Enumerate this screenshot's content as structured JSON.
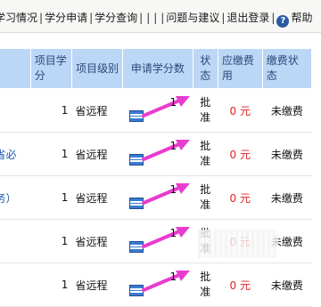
{
  "nav": {
    "items": [
      "学习情况",
      "学分申请",
      "学分查询",
      "|",
      "|",
      "问题与建议",
      "退出登录"
    ],
    "help_label": "帮助"
  },
  "table": {
    "headers": [
      "",
      "项目学分",
      "项目级别",
      "申请学分数",
      "状态",
      "应缴费用",
      "缴费状态"
    ],
    "rows": [
      {
        "name": "",
        "credit": "1",
        "level": "省远程",
        "apply": "1",
        "status": "批准",
        "fee": "0 元",
        "pay_status": "未缴费"
      },
      {
        "name": "省必",
        "credit": "1",
        "level": "省远程",
        "apply": "1",
        "status": "批准",
        "fee": "0 元",
        "pay_status": "未缴费"
      },
      {
        "name": "务）",
        "credit": "1",
        "level": "省远程",
        "apply": "1",
        "status": "批准",
        "fee": "0 元",
        "pay_status": "未缴费"
      },
      {
        "name": "",
        "credit": "1",
        "level": "省远程",
        "apply": "1",
        "status": "批准",
        "fee": "0 元",
        "pay_status": "未缴费"
      },
      {
        "name": "",
        "credit": "1",
        "level": "省远程",
        "apply": "1",
        "status": "批准",
        "fee": "0 元",
        "pay_status": "未缴费"
      }
    ]
  },
  "colors": {
    "header_bg": "#bcd6f5",
    "header_text": "#2a4a7a",
    "fee": "#e02020",
    "arrow": "#e83ccf",
    "link": "#1a56b0"
  },
  "icons": {
    "doc": "document-edit-icon",
    "help": "help-icon",
    "annotation": "pink-arrow-icon"
  }
}
